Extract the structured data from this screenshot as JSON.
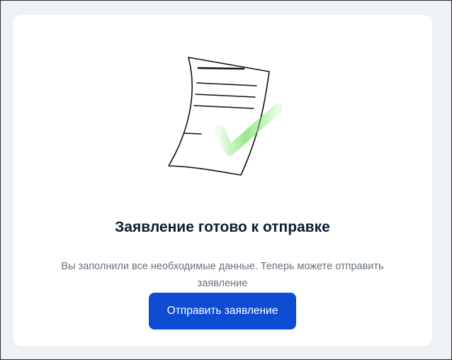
{
  "card": {
    "title": "Заявление готово к отправке",
    "description": "Вы заполнили все необходимые данные. Теперь можете отправить заявление",
    "submit_label": "Отправить заявление"
  },
  "illustration": {
    "icon": "document-checkmark-icon",
    "check_color": "#7be26a"
  },
  "colors": {
    "background": "#eef1f6",
    "card": "#ffffff",
    "title": "#0b1f33",
    "description": "#66727f",
    "button": "#0d4cd3",
    "button_text": "#ffffff"
  }
}
